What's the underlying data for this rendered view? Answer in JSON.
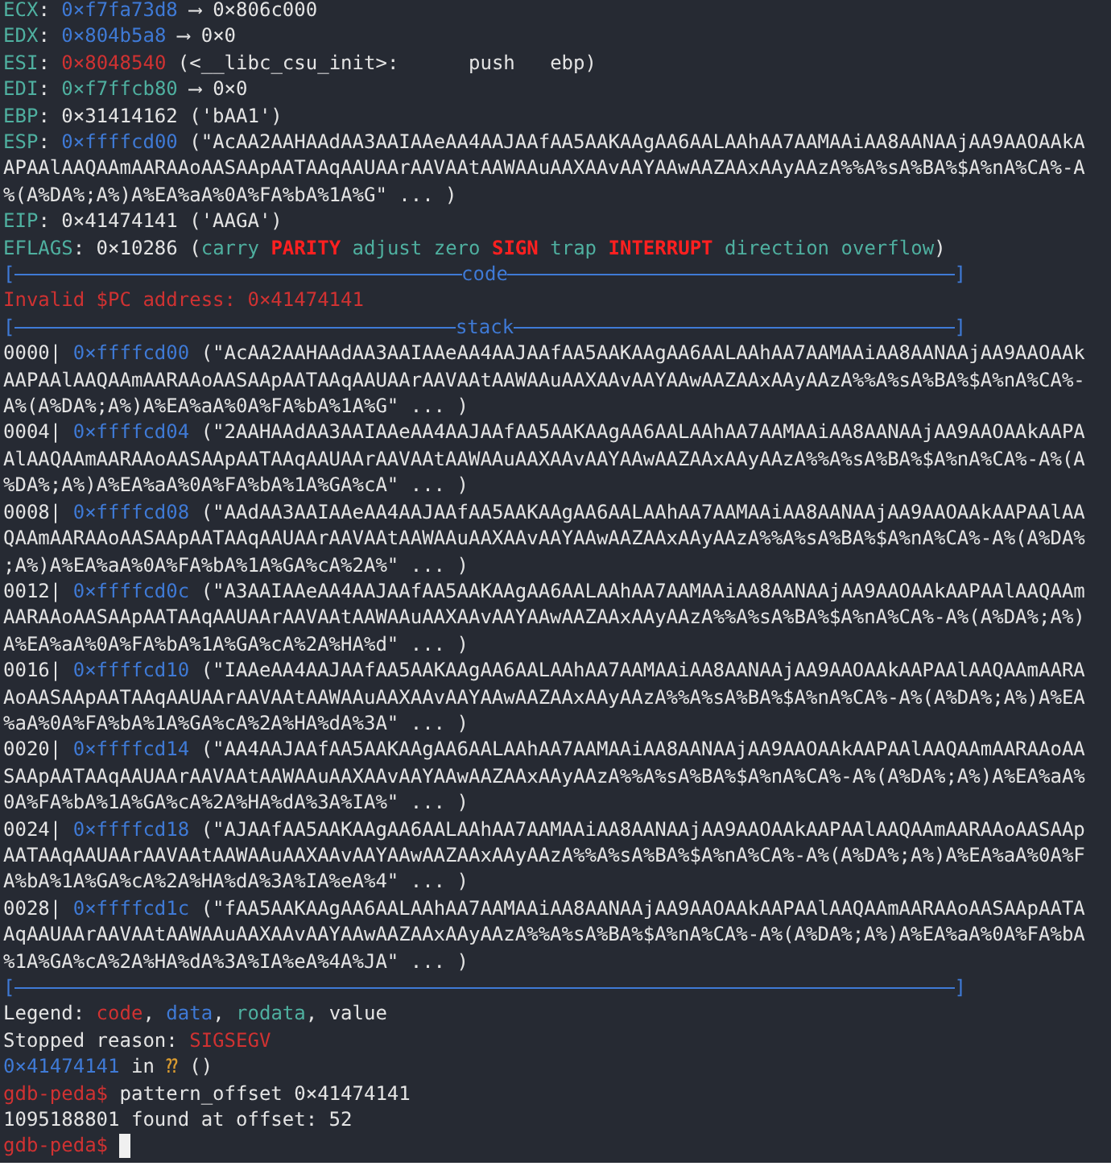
{
  "terminal": {
    "lines": [
      {
        "kind": "text",
        "segments": [
          {
            "text": "ECX",
            "kind": "label"
          },
          {
            "text": ": ",
            "kind": "plain"
          },
          {
            "text": "0×f7fa73d8",
            "kind": "data"
          },
          {
            "text": " ⟶ 0×806c000",
            "kind": "plain"
          }
        ]
      },
      {
        "kind": "text",
        "segments": [
          {
            "text": "EDX",
            "kind": "label"
          },
          {
            "text": ": ",
            "kind": "plain"
          },
          {
            "text": "0×804b5a8",
            "kind": "data"
          },
          {
            "text": " ⟶ 0×0",
            "kind": "plain"
          }
        ]
      },
      {
        "kind": "text",
        "segments": [
          {
            "text": "ESI",
            "kind": "label"
          },
          {
            "text": ": ",
            "kind": "plain"
          },
          {
            "text": "0×8048540",
            "kind": "code"
          },
          {
            "text": " (<__libc_csu_init>:      push   ebp)",
            "kind": "plain"
          }
        ]
      },
      {
        "kind": "text",
        "segments": [
          {
            "text": "EDI",
            "kind": "label"
          },
          {
            "text": ": ",
            "kind": "plain"
          },
          {
            "text": "0×f7ffcb80",
            "kind": "rodata"
          },
          {
            "text": " ⟶ 0×0",
            "kind": "plain"
          }
        ]
      },
      {
        "kind": "text",
        "segments": [
          {
            "text": "EBP",
            "kind": "label"
          },
          {
            "text": ": 0×31414162 ('bAA1')",
            "kind": "plain"
          }
        ]
      },
      {
        "kind": "text",
        "segments": [
          {
            "text": "ESP",
            "kind": "label"
          },
          {
            "text": ": ",
            "kind": "plain"
          },
          {
            "text": "0×ffffcd00",
            "kind": "data"
          },
          {
            "text": " (\"AcAA2AAHAAdAA3AAIAAeAA4AAJAAfAA5AAKAAgAA6AALAAhAA7AAMAAiAA8AANAAjAA9AAOAAkA",
            "kind": "plain"
          }
        ]
      },
      {
        "kind": "text",
        "segments": [
          {
            "text": "APAAlAAQAAmAARAAoAASAApAATAAqAAUAArAAVAAtAAWAAuAAXAAvAAYAAwAAZAAxAAyAAzA%%A%sA%BA%$A%nA%CA%-A",
            "kind": "plain"
          }
        ]
      },
      {
        "kind": "text",
        "segments": [
          {
            "text": "%(A%DA%;A%)A%EA%aA%0A%FA%bA%1A%G\" ... )",
            "kind": "plain"
          }
        ]
      },
      {
        "kind": "text",
        "segments": [
          {
            "text": "EIP",
            "kind": "label"
          },
          {
            "text": ": 0×41474141 ('AAGA')",
            "kind": "plain"
          }
        ]
      },
      {
        "kind": "text",
        "segments": [
          {
            "text": "EFLAGS",
            "kind": "label"
          },
          {
            "text": ": 0×10286 (",
            "kind": "plain"
          },
          {
            "text": "carry ",
            "kind": "rodata"
          },
          {
            "text": "PARITY",
            "kind": "flag"
          },
          {
            "text": " adjust zero ",
            "kind": "rodata"
          },
          {
            "text": "SIGN",
            "kind": "flag"
          },
          {
            "text": " trap ",
            "kind": "rodata"
          },
          {
            "text": "INTERRUPT",
            "kind": "flag"
          },
          {
            "text": " direction overflow",
            "kind": "rodata"
          },
          {
            "text": ")",
            "kind": "plain"
          }
        ]
      },
      {
        "kind": "rule",
        "open": "[",
        "title": "code",
        "close": "]"
      },
      {
        "kind": "text",
        "segments": [
          {
            "text": "Invalid $PC address: 0×41474141",
            "kind": "code"
          }
        ]
      },
      {
        "kind": "rule",
        "open": "[",
        "title": "stack",
        "close": "]"
      },
      {
        "kind": "text",
        "segments": [
          {
            "text": "0000| ",
            "kind": "plain"
          },
          {
            "text": "0×ffffcd00",
            "kind": "data"
          },
          {
            "text": " (\"AcAA2AAHAAdAA3AAIAAeAA4AAJAAfAA5AAKAAgAA6AALAAhAA7AAMAAiAA8AANAAjAA9AAOAAk",
            "kind": "plain"
          }
        ]
      },
      {
        "kind": "text",
        "segments": [
          {
            "text": "AAPAAlAAQAAmAARAAoAASAApAATAAqAAUAArAAVAAtAAWAAuAAXAAvAAYAAwAAZAAxAAyAAzA%%A%sA%BA%$A%nA%CA%-",
            "kind": "plain"
          }
        ]
      },
      {
        "kind": "text",
        "segments": [
          {
            "text": "A%(A%DA%;A%)A%EA%aA%0A%FA%bA%1A%G\" ... )",
            "kind": "plain"
          }
        ]
      },
      {
        "kind": "text",
        "segments": [
          {
            "text": "0004| ",
            "kind": "plain"
          },
          {
            "text": "0×ffffcd04",
            "kind": "data"
          },
          {
            "text": " (\"2AAHAAdAA3AAIAAeAA4AAJAAfAA5AAKAAgAA6AALAAhAA7AAMAAiAA8AANAAjAA9AAOAAkAAPA",
            "kind": "plain"
          }
        ]
      },
      {
        "kind": "text",
        "segments": [
          {
            "text": "AlAAQAAmAARAAoAASAApAATAAqAAUAArAAVAAtAAWAAuAAXAAvAAYAAwAAZAAxAAyAAzA%%A%sA%BA%$A%nA%CA%-A%(A",
            "kind": "plain"
          }
        ]
      },
      {
        "kind": "text",
        "segments": [
          {
            "text": "%DA%;A%)A%EA%aA%0A%FA%bA%1A%GA%cA\" ... )",
            "kind": "plain"
          }
        ]
      },
      {
        "kind": "text",
        "segments": [
          {
            "text": "0008| ",
            "kind": "plain"
          },
          {
            "text": "0×ffffcd08",
            "kind": "data"
          },
          {
            "text": " (\"AAdAA3AAIAAeAA4AAJAAfAA5AAKAAgAA6AALAAhAA7AAMAAiAA8AANAAjAA9AAOAAkAAPAAlAA",
            "kind": "plain"
          }
        ]
      },
      {
        "kind": "text",
        "segments": [
          {
            "text": "QAAmAARAAoAASAApAATAAqAAUAArAAVAAtAAWAAuAAXAAvAAYAAwAAZAAxAAyAAzA%%A%sA%BA%$A%nA%CA%-A%(A%DA%",
            "kind": "plain"
          }
        ]
      },
      {
        "kind": "text",
        "segments": [
          {
            "text": ";A%)A%EA%aA%0A%FA%bA%1A%GA%cA%2A%\" ... )",
            "kind": "plain"
          }
        ]
      },
      {
        "kind": "text",
        "segments": [
          {
            "text": "0012| ",
            "kind": "plain"
          },
          {
            "text": "0×ffffcd0c",
            "kind": "data"
          },
          {
            "text": " (\"A3AAIAAeAA4AAJAAfAA5AAKAAgAA6AALAAhAA7AAMAAiAA8AANAAjAA9AAOAAkAAPAAlAAQAAm",
            "kind": "plain"
          }
        ]
      },
      {
        "kind": "text",
        "segments": [
          {
            "text": "AARAAoAASAApAATAAqAAUAArAAVAAtAAWAAuAAXAAvAAYAAwAAZAAxAAyAAzA%%A%sA%BA%$A%nA%CA%-A%(A%DA%;A%)",
            "kind": "plain"
          }
        ]
      },
      {
        "kind": "text",
        "segments": [
          {
            "text": "A%EA%aA%0A%FA%bA%1A%GA%cA%2A%HA%d\" ... )",
            "kind": "plain"
          }
        ]
      },
      {
        "kind": "text",
        "segments": [
          {
            "text": "0016| ",
            "kind": "plain"
          },
          {
            "text": "0×ffffcd10",
            "kind": "data"
          },
          {
            "text": " (\"IAAeAA4AAJAAfAA5AAKAAgAA6AALAAhAA7AAMAAiAA8AANAAjAA9AAOAAkAAPAAlAAQAAmAARA",
            "kind": "plain"
          }
        ]
      },
      {
        "kind": "text",
        "segments": [
          {
            "text": "AoAASAApAATAAqAAUAArAAVAAtAAWAAuAAXAAvAAYAAwAAZAAxAAyAAzA%%A%sA%BA%$A%nA%CA%-A%(A%DA%;A%)A%EA",
            "kind": "plain"
          }
        ]
      },
      {
        "kind": "text",
        "segments": [
          {
            "text": "%aA%0A%FA%bA%1A%GA%cA%2A%HA%dA%3A\" ... )",
            "kind": "plain"
          }
        ]
      },
      {
        "kind": "text",
        "segments": [
          {
            "text": "0020| ",
            "kind": "plain"
          },
          {
            "text": "0×ffffcd14",
            "kind": "data"
          },
          {
            "text": " (\"AA4AAJAAfAA5AAKAAgAA6AALAAhAA7AAMAAiAA8AANAAjAA9AAOAAkAAPAAlAAQAAmAARAAoAA",
            "kind": "plain"
          }
        ]
      },
      {
        "kind": "text",
        "segments": [
          {
            "text": "SAApAATAAqAAUAArAAVAAtAAWAAuAAXAAvAAYAAwAAZAAxAAyAAzA%%A%sA%BA%$A%nA%CA%-A%(A%DA%;A%)A%EA%aA%",
            "kind": "plain"
          }
        ]
      },
      {
        "kind": "text",
        "segments": [
          {
            "text": "0A%FA%bA%1A%GA%cA%2A%HA%dA%3A%IA%\" ... )",
            "kind": "plain"
          }
        ]
      },
      {
        "kind": "text",
        "segments": [
          {
            "text": "0024| ",
            "kind": "plain"
          },
          {
            "text": "0×ffffcd18",
            "kind": "data"
          },
          {
            "text": " (\"AJAAfAA5AAKAAgAA6AALAAhAA7AAMAAiAA8AANAAjAA9AAOAAkAAPAAlAAQAAmAARAAoAASAAp",
            "kind": "plain"
          }
        ]
      },
      {
        "kind": "text",
        "segments": [
          {
            "text": "AATAAqAAUAArAAVAAtAAWAAuAAXAAvAAYAAwAAZAAxAAyAAzA%%A%sA%BA%$A%nA%CA%-A%(A%DA%;A%)A%EA%aA%0A%F",
            "kind": "plain"
          }
        ]
      },
      {
        "kind": "text",
        "segments": [
          {
            "text": "A%bA%1A%GA%cA%2A%HA%dA%3A%IA%eA%4\" ... )",
            "kind": "plain"
          }
        ]
      },
      {
        "kind": "text",
        "segments": [
          {
            "text": "0028| ",
            "kind": "plain"
          },
          {
            "text": "0×ffffcd1c",
            "kind": "data"
          },
          {
            "text": " (\"fAA5AAKAAgAA6AALAAhAA7AAMAAiAA8AANAAjAA9AAOAAkAAPAAlAAQAAmAARAAoAASAApAATA",
            "kind": "plain"
          }
        ]
      },
      {
        "kind": "text",
        "segments": [
          {
            "text": "AqAAUAArAAVAAtAAWAAuAAXAAvAAYAAwAAZAAxAAyAAzA%%A%sA%BA%$A%nA%CA%-A%(A%DA%;A%)A%EA%aA%0A%FA%bA",
            "kind": "plain"
          }
        ]
      },
      {
        "kind": "text",
        "segments": [
          {
            "text": "%1A%GA%cA%2A%HA%dA%3A%IA%eA%4A%JA\" ... )",
            "kind": "plain"
          }
        ]
      },
      {
        "kind": "rule",
        "open": "[",
        "close": "]"
      },
      {
        "kind": "text",
        "segments": [
          {
            "text": "Legend: ",
            "kind": "plain"
          },
          {
            "text": "code",
            "kind": "code"
          },
          {
            "text": ", ",
            "kind": "plain"
          },
          {
            "text": "data",
            "kind": "data"
          },
          {
            "text": ", ",
            "kind": "plain"
          },
          {
            "text": "rodata",
            "kind": "rodata"
          },
          {
            "text": ", value",
            "kind": "plain"
          }
        ]
      },
      {
        "kind": "text",
        "segments": [
          {
            "text": "Stopped reason: ",
            "kind": "plain"
          },
          {
            "text": "SIGSEGV",
            "kind": "code"
          }
        ]
      },
      {
        "kind": "text",
        "segments": [
          {
            "text": "0×41474141",
            "kind": "data"
          },
          {
            "text": " in ",
            "kind": "plain"
          },
          {
            "text": "⁇",
            "kind": "unknown"
          },
          {
            "text": " ()",
            "kind": "plain"
          }
        ]
      },
      {
        "kind": "text",
        "segments": [
          {
            "text": "gdb-peda$",
            "kind": "code"
          },
          {
            "text": " pattern_offset 0×41474141",
            "kind": "plain"
          }
        ]
      },
      {
        "kind": "text",
        "segments": [
          {
            "text": "1095188801 found at offset: 52",
            "kind": "plain"
          }
        ]
      },
      {
        "kind": "prompt",
        "segments": [
          {
            "text": "gdb-peda$",
            "kind": "code"
          }
        ]
      }
    ]
  }
}
